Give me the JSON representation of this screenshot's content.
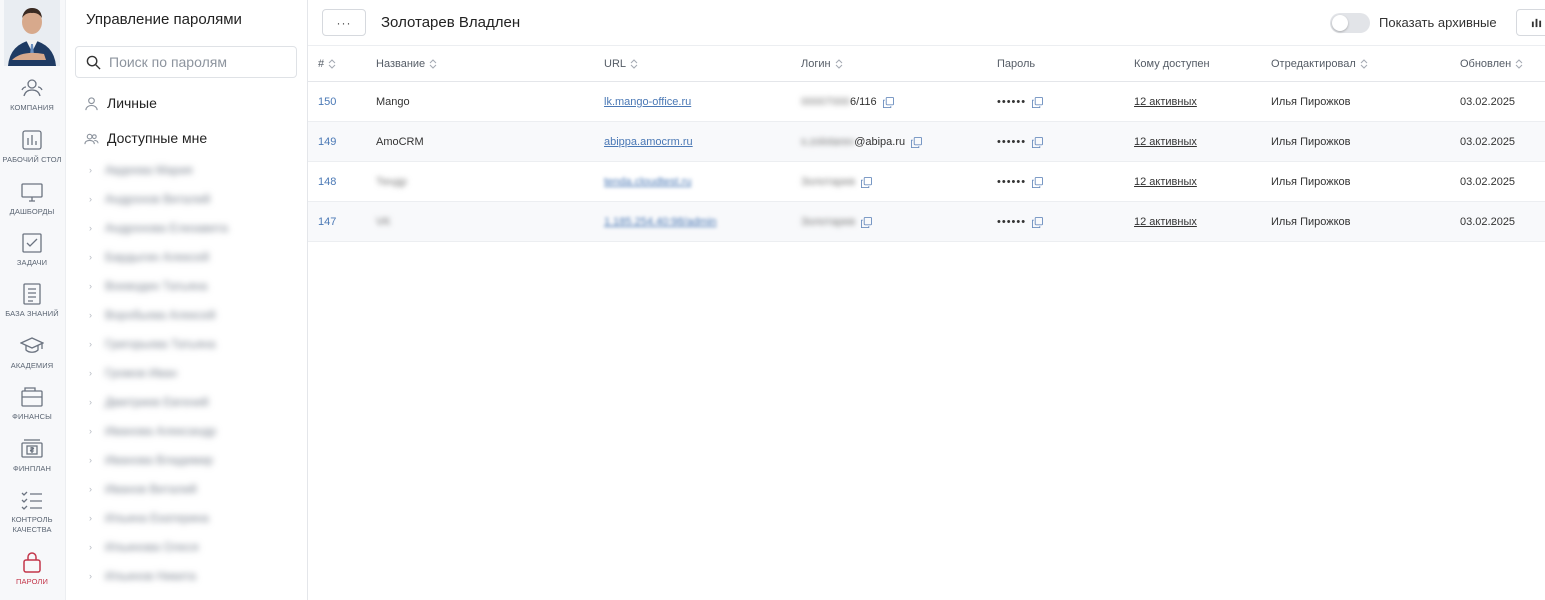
{
  "rail": {
    "items": [
      {
        "label": "КОМПАНИЯ",
        "icon": "company-icon"
      },
      {
        "label": "РАБОЧИЙ СТОЛ",
        "icon": "desktop-icon"
      },
      {
        "label": "ДАШБОРДЫ",
        "icon": "monitor-icon"
      },
      {
        "label": "ЗАДАЧИ",
        "icon": "checkbox-icon"
      },
      {
        "label": "БАЗА ЗНАНИЙ",
        "icon": "document-icon"
      },
      {
        "label": "АКАДЕМИЯ",
        "icon": "graduation-cap-icon"
      },
      {
        "label": "ФИНАНСЫ",
        "icon": "wallet-icon"
      },
      {
        "label": "ФИНПЛАН",
        "icon": "cash-register-icon"
      },
      {
        "label": "КОНТРОЛЬ КАЧЕСТВА",
        "icon": "checklist-icon"
      },
      {
        "label": "ПАРОЛИ",
        "icon": "lock-icon"
      }
    ],
    "active_color": "#c3364a"
  },
  "tree": {
    "title": "Управление паролями",
    "search_placeholder": "Поиск по паролям",
    "personal_label": "Личные",
    "shared_label": "Доступные мне",
    "people": [
      "Авдеева Мария",
      "Андронов Виталий",
      "Андронова Елизавета",
      "Бардыгин Алексей",
      "Воеводин Татьяна",
      "Воробьева Алексей",
      "Григорьева Татьяна",
      "Громов Иван",
      "Дмитриев Евгений",
      "Иванова Александр",
      "Иванова Владимир",
      "Иванов Виталий",
      "Ильина Екатерина",
      "Ильинова Олеся",
      "Ильинов Никита"
    ]
  },
  "topbar": {
    "menu_label": "···",
    "user_name": "Золотарев Владлен",
    "archive_label": "Показать архивные"
  },
  "table": {
    "headers": {
      "id": "#",
      "name": "Название",
      "url": "URL",
      "login": "Логин",
      "password": "Пароль",
      "access": "Кому доступен",
      "edited_by": "Отредактировал",
      "updated": "Обновлен"
    },
    "rows": [
      {
        "id": "150",
        "name": "Mango",
        "url": "lk.mango-office.ru",
        "login_hidden": "00007000",
        "login_visible": "6/116",
        "password": "••••••",
        "access": "12 активных",
        "edited_by": "Илья Пирожков",
        "updated": "03.02.2025"
      },
      {
        "id": "149",
        "name": "AmoCRM",
        "url": "abippa.amocrm.ru",
        "login_hidden": "s.zolotarev",
        "login_visible": "@abipa.ru",
        "password": "••••••",
        "access": "12 активных",
        "edited_by": "Илья Пирожков",
        "updated": "03.02.2025"
      },
      {
        "id": "148",
        "name": "Тендр",
        "url": "tenda.cloudtest.ru",
        "login_hidden": "Золотарев",
        "login_visible": "",
        "password": "••••••",
        "access": "12 активных",
        "edited_by": "Илья Пирожков",
        "updated": "03.02.2025"
      },
      {
        "id": "147",
        "name": "VK",
        "url": "1.185.254.40:98/admin",
        "login_hidden": "Золотарев",
        "login_visible": "",
        "password": "••••••",
        "access": "12 активных",
        "edited_by": "Илья Пирожков",
        "updated": "03.02.2025"
      }
    ]
  }
}
